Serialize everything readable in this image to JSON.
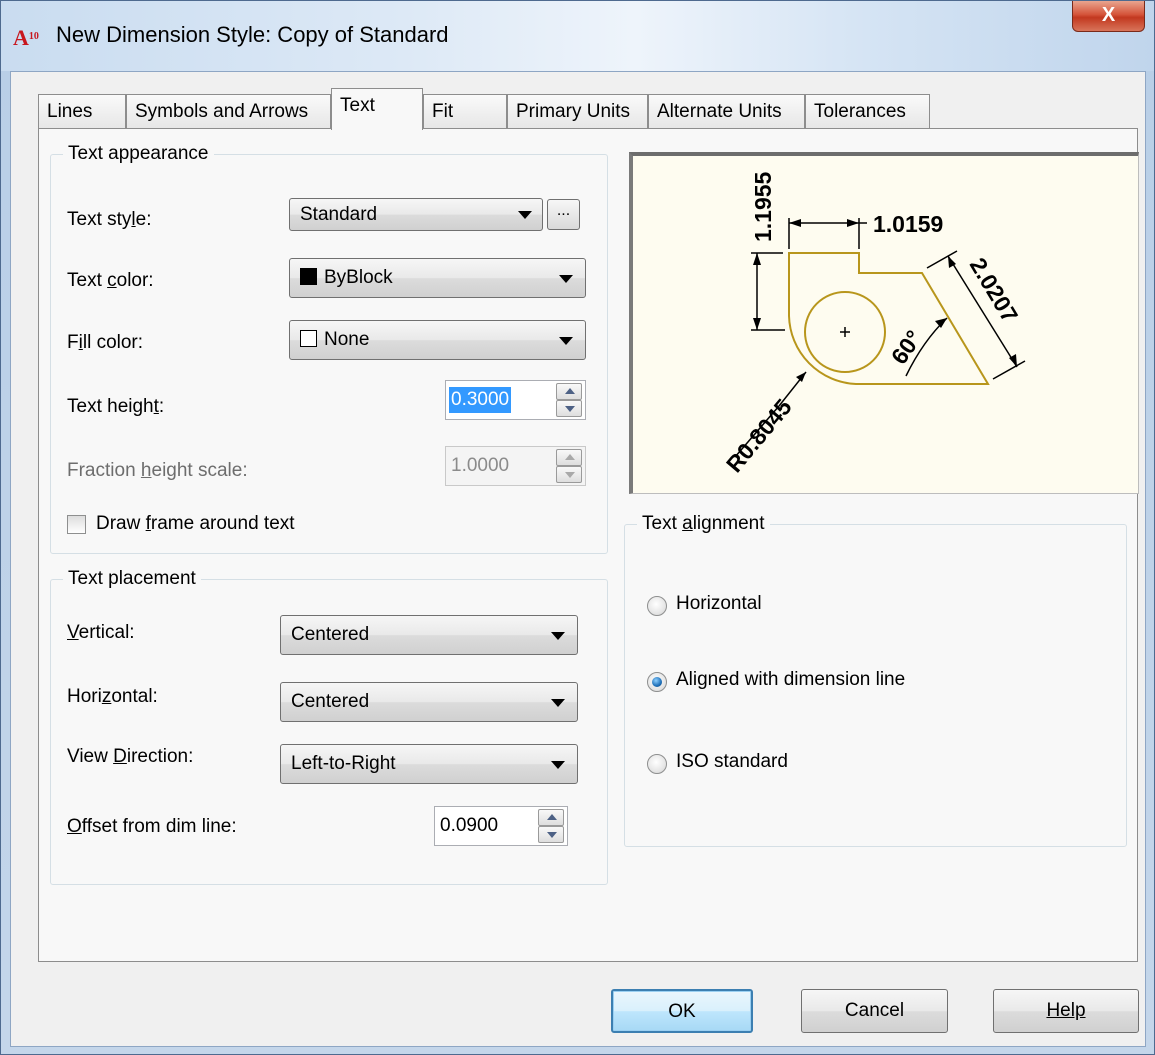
{
  "window": {
    "title": "New Dimension Style: Copy of Standard",
    "app_icon_main": "A",
    "app_icon_sub": "10",
    "close_glyph": "X"
  },
  "tabs": [
    {
      "label": "Lines",
      "active": false
    },
    {
      "label": "Symbols and Arrows",
      "active": false
    },
    {
      "label": "Text",
      "active": true
    },
    {
      "label": "Fit",
      "active": false
    },
    {
      "label": "Primary Units",
      "active": false
    },
    {
      "label": "Alternate Units",
      "active": false
    },
    {
      "label": "Tolerances",
      "active": false
    }
  ],
  "text_appearance": {
    "group_label": "Text appearance",
    "text_style_label": "Text style:",
    "text_style_value": "Standard",
    "ellipsis_label": "...",
    "text_color_label": "Text color:",
    "text_color_value": "ByBlock",
    "text_color_swatch": "#000000",
    "fill_color_label": "Fill color:",
    "fill_color_value": "None",
    "fill_color_swatch": "#ffffff",
    "text_height_label": "Text height:",
    "text_height_value": "0.3000",
    "fraction_height_label": "Fraction height scale:",
    "fraction_height_value": "1.0000",
    "draw_frame_label": "Draw frame around text",
    "draw_frame_checked": false
  },
  "text_placement": {
    "group_label": "Text placement",
    "vertical_label": "Vertical:",
    "vertical_value": "Centered",
    "horizontal_label": "Horizontal:",
    "horizontal_value": "Centered",
    "view_direction_label": "View Direction:",
    "view_direction_value": "Left-to-Right",
    "offset_label": "Offset from dim line:",
    "offset_value": "0.0900"
  },
  "preview": {
    "dim_vertical": "1.1955",
    "dim_horizontal": "1.0159",
    "dim_aligned": "2.0207",
    "dim_angle": "60°",
    "dim_radius": "R0.8045",
    "geometry_color": "#b8961c"
  },
  "text_alignment": {
    "group_label": "Text alignment",
    "options": [
      {
        "label": "Horizontal",
        "checked": false
      },
      {
        "label": "Aligned with dimension line",
        "checked": true
      },
      {
        "label": "ISO standard",
        "checked": false
      }
    ]
  },
  "buttons": {
    "ok": "OK",
    "cancel": "Cancel",
    "help": "Help"
  }
}
